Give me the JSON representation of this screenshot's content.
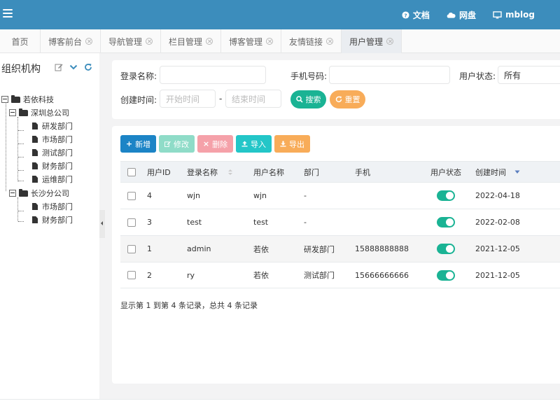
{
  "header": {
    "links": [
      {
        "label": "文档",
        "icon": "question-circle-icon"
      },
      {
        "label": "网盘",
        "icon": "cloud-icon"
      },
      {
        "label": "mblog",
        "icon": "monitor-icon"
      }
    ],
    "accent": "#3c8dbc"
  },
  "tabs": [
    {
      "label": "首页",
      "closable": false
    },
    {
      "label": "博客前台",
      "closable": true
    },
    {
      "label": "导航管理",
      "closable": true
    },
    {
      "label": "栏目管理",
      "closable": true
    },
    {
      "label": "博客管理",
      "closable": true
    },
    {
      "label": "友情链接",
      "closable": true
    },
    {
      "label": "用户管理",
      "closable": true,
      "active": true
    }
  ],
  "sidebar": {
    "title": "组织机构",
    "tree": {
      "root": "若依科技",
      "branches": [
        {
          "label": "深圳总公司",
          "children": [
            "研发部门",
            "市场部门",
            "测试部门",
            "财务部门",
            "运维部门"
          ]
        },
        {
          "label": "长沙分公司",
          "children": [
            "市场部门",
            "财务部门"
          ]
        }
      ]
    }
  },
  "search": {
    "login_name_label": "登录名称:",
    "phone_label": "手机号码:",
    "status_label": "用户状态:",
    "status_value": "所有",
    "created_label": "创建时间:",
    "start_placeholder": "开始时间",
    "separator": "-",
    "end_placeholder": "结束时间",
    "search_button": "搜索",
    "reset_button": "重置"
  },
  "toolbar": {
    "add": "新增",
    "edit": "修改",
    "delete": "删除",
    "import": "导入",
    "export": "导出"
  },
  "table": {
    "columns": [
      "用户ID",
      "登录名称",
      "用户名称",
      "部门",
      "手机",
      "用户状态",
      "创建时间"
    ],
    "rows": [
      {
        "id": "4",
        "login": "wjn",
        "name": "wjn",
        "dept": "-",
        "phone": "",
        "status": true,
        "created": "2022-04-18"
      },
      {
        "id": "3",
        "login": "test",
        "name": "test",
        "dept": "-",
        "phone": "",
        "status": true,
        "created": "2022-02-08"
      },
      {
        "id": "1",
        "login": "admin",
        "name": "若依",
        "dept": "研发部门",
        "phone": "15888888888",
        "status": true,
        "created": "2021-12-05"
      },
      {
        "id": "2",
        "login": "ry",
        "name": "若依",
        "dept": "测试部门",
        "phone": "15666666666",
        "status": true,
        "created": "2021-12-05"
      }
    ],
    "pagination_text": "显示第 1 到第 4 条记录，总共 4 条记录"
  }
}
